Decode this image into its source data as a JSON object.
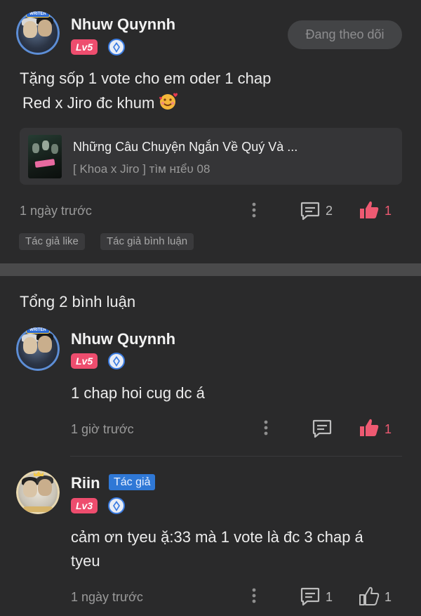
{
  "post": {
    "author": "Nhuw Quynnh",
    "level": "Lv5",
    "follow_label": "Đang theo dõi",
    "text_line1": "Tặng sốp 1 vote cho em oder 1 chap",
    "text_line2": "Red x Jiro đc khum",
    "book": {
      "title": "Những Câu Chuyện Ngắn Về Quý Và ...",
      "subtitle": "[ Khoa x Jiro ] ᴛìᴍ ʜɪểᴜ 08"
    },
    "time": "1 ngày trước",
    "comment_count": "2",
    "like_count": "1",
    "tags": [
      "Tác giả like",
      "Tác giả bình luận"
    ]
  },
  "comments_header": "Tổng 2 bình luận",
  "comments": [
    {
      "author": "Nhuw Quynnh",
      "level": "Lv5",
      "text": "1 chap hoi cug dc á",
      "time": "1 giờ trước",
      "like_count": "1"
    },
    {
      "author": "Riin",
      "author_badge": "Tác giả",
      "level": "Lv3",
      "text_line1": "cảm ơn tyeu ặ:33 mà 1 vote là đc 3 chap á",
      "text_line2": "tyeu",
      "time": "1 ngày trước",
      "comment_count": "1",
      "like_count": "1"
    }
  ],
  "colors": {
    "background": "#2a2a2b",
    "accent_red": "#ee5a72",
    "level_badge": "#ee4d6e",
    "author_badge": "#2f78d6"
  },
  "icons": [
    "more-vertical-icon",
    "comment-icon",
    "like-filled-icon",
    "like-outline-icon",
    "diamond-icon",
    "smiling-face-hearts-icon"
  ]
}
